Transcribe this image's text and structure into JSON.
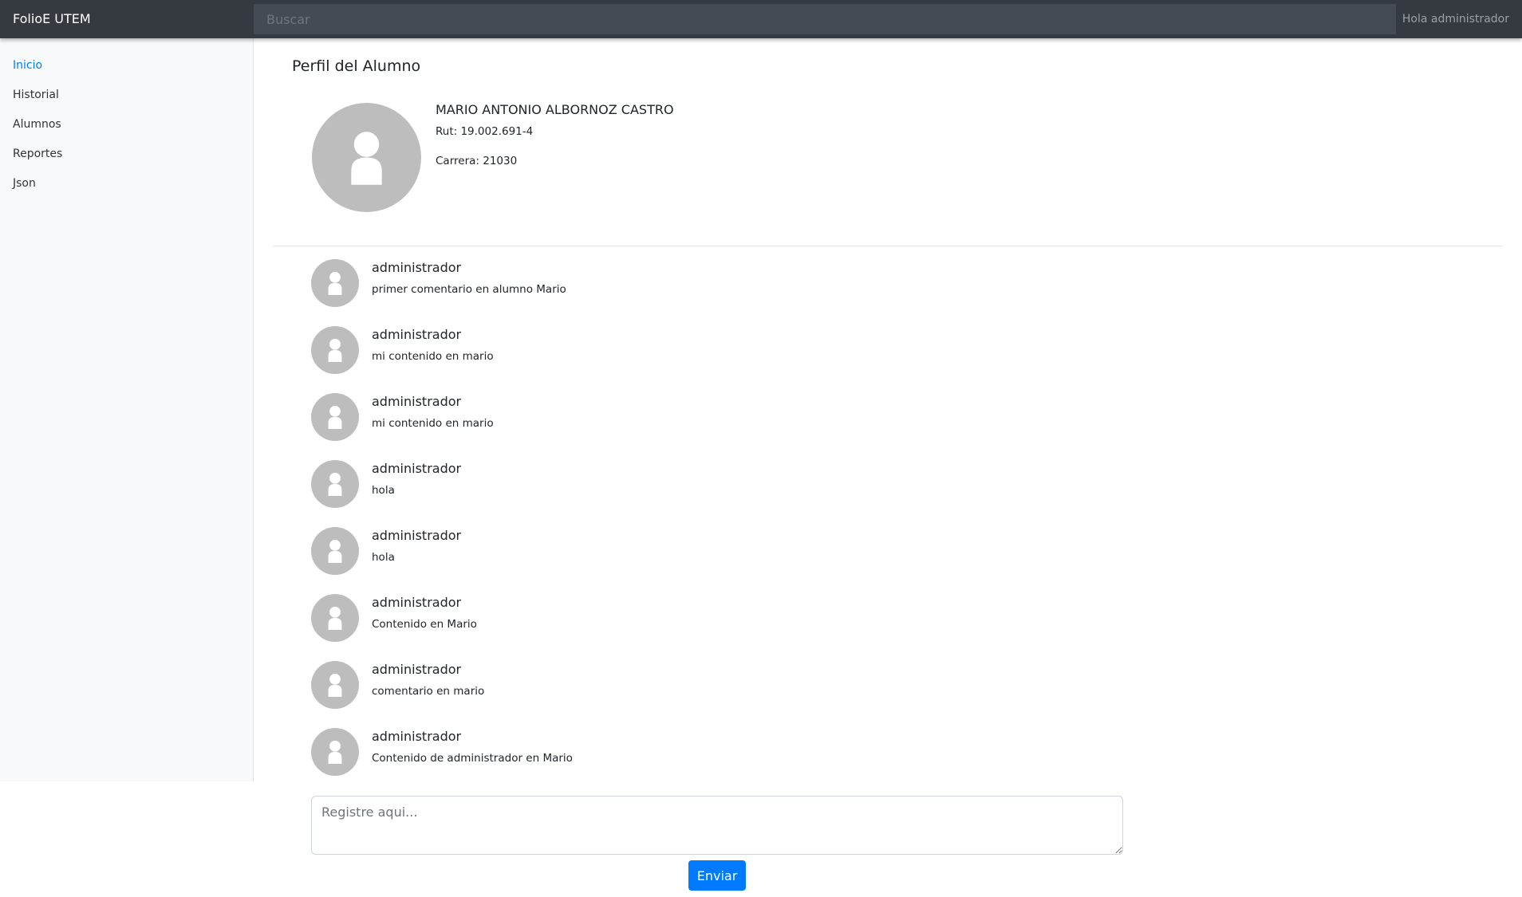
{
  "navbar": {
    "brand": "FolioE UTEM",
    "search_placeholder": "Buscar",
    "greeting": "Hola administrador"
  },
  "sidebar": {
    "items": [
      {
        "label": "Inicio",
        "active": true
      },
      {
        "label": "Historial",
        "active": false
      },
      {
        "label": "Alumnos",
        "active": false
      },
      {
        "label": "Reportes",
        "active": false
      },
      {
        "label": "Json",
        "active": false
      }
    ]
  },
  "main": {
    "title": "Perfil del Alumno",
    "student": {
      "name": "MARIO ANTONIO ALBORNOZ CASTRO",
      "rut": "Rut: 19.002.691-4",
      "carrera": "Carrera: 21030"
    },
    "comments": [
      {
        "author": "administrador",
        "text": "primer comentario en alumno Mario"
      },
      {
        "author": "administrador",
        "text": "mi contenido en mario"
      },
      {
        "author": "administrador",
        "text": "mi contenido en mario"
      },
      {
        "author": "administrador",
        "text": "hola"
      },
      {
        "author": "administrador",
        "text": "hola"
      },
      {
        "author": "administrador",
        "text": "Contenido en Mario"
      },
      {
        "author": "administrador",
        "text": "comentario en mario"
      },
      {
        "author": "administrador",
        "text": "Contenido de administrador en Mario"
      }
    ],
    "form": {
      "placeholder": "Registre aqui...",
      "submit_label": "Enviar"
    }
  },
  "colors": {
    "navbar_bg": "#343a40",
    "accent": "#007bff",
    "avatar_bg": "#bdbdbd",
    "sidebar_bg": "#f8f9fa"
  }
}
